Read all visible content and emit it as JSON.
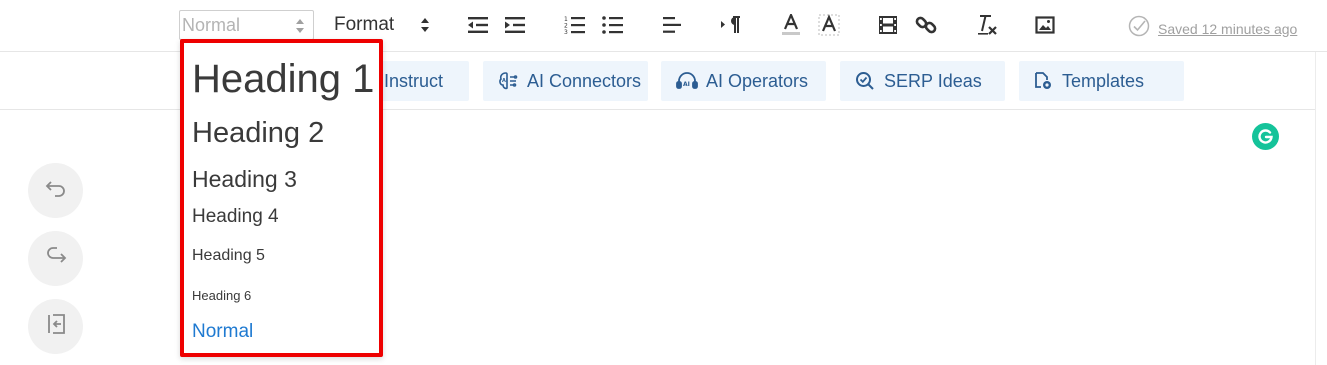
{
  "toolbar": {
    "style_select": {
      "value": "Normal"
    },
    "format_label": "Format",
    "icons": [
      "outdent-icon",
      "indent-icon",
      "numbered-list-icon",
      "bullet-list-icon",
      "align-left-icon",
      "paragraph-direction-icon",
      "text-color-icon",
      "background-color-icon",
      "video-icon",
      "link-icon",
      "clear-format-icon",
      "image-icon"
    ],
    "saved_text": "Saved 12 minutes ago"
  },
  "ai_toolbar": {
    "buttons": [
      {
        "label": "Instruct"
      },
      {
        "label": "AI Connectors",
        "icon": "ai-brain-icon"
      },
      {
        "label": "AI Operators",
        "icon": "ai-headset-icon"
      },
      {
        "label": "SERP Ideas",
        "icon": "search-check-icon"
      },
      {
        "label": "Templates",
        "icon": "templates-icon"
      }
    ]
  },
  "side_actions": [
    "undo-icon",
    "redo-icon",
    "collapse-panel-icon"
  ],
  "dropdown": {
    "items": [
      {
        "label": "Heading 1"
      },
      {
        "label": "Heading 2"
      },
      {
        "label": "Heading 3"
      },
      {
        "label": "Heading 4"
      },
      {
        "label": "Heading 5"
      },
      {
        "label": "Heading 6"
      },
      {
        "label": "Normal",
        "selected": true
      }
    ]
  },
  "colors": {
    "highlight_border": "#ee0000",
    "accent_blue": "#1f7ad1",
    "ai_button_bg": "#eef5fc",
    "ai_button_text": "#2c5d92",
    "grammarly_green": "#15c39a"
  }
}
